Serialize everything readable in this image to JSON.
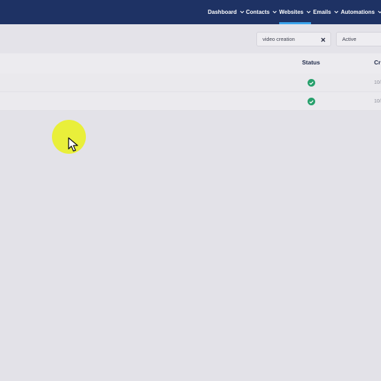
{
  "nav": {
    "items": [
      {
        "label": "Dashboard"
      },
      {
        "label": "Contacts"
      },
      {
        "label": "Websites"
      },
      {
        "label": "Emails"
      },
      {
        "label": "Automations"
      }
    ]
  },
  "filters": {
    "search_value": "video creation",
    "status_value": "Active"
  },
  "table": {
    "headers": {
      "status": "Status",
      "created": "Cr"
    },
    "rows": [
      {
        "status_icon": "check-circle-icon",
        "date": "10/"
      },
      {
        "status_icon": "check-circle-icon",
        "date": "10/"
      }
    ]
  },
  "colors": {
    "nav_bg": "#1e3264",
    "active_tab_underline": "#3ba4ec",
    "status_success": "#27a06c",
    "cursor_highlight": "#e9ef3a"
  }
}
